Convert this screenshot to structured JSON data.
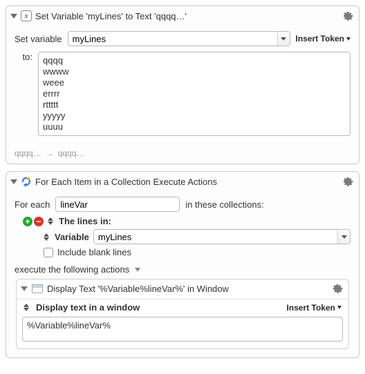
{
  "action1": {
    "title": "Set Variable 'myLines' to Text 'qqqq…'",
    "set_variable_label": "Set variable",
    "variable_name": "myLines",
    "insert_token_label": "Insert Token",
    "to_label": "to:",
    "text_value": "qqqq\nwwww\nweee\nerrrr\nrttttt\nyyyyy\nuuuu",
    "result_from": "qqqq…",
    "result_arrow": "→",
    "result_to": "qqqq…"
  },
  "action2": {
    "title": "For Each Item in a Collection Execute Actions",
    "for_each_label": "For each",
    "loop_var": "lineVar",
    "in_collections_label": "in these collections:",
    "lines_in_label": "The lines in:",
    "variable_label": "Variable",
    "collection_variable": "myLines",
    "include_blank_label": "Include blank lines",
    "execute_label": "execute the following actions",
    "sub": {
      "title": "Display Text '%Variable%lineVar%' in Window",
      "mode_label": "Display text in a window",
      "insert_token_label": "Insert Token",
      "text_value": "%Variable%lineVar%"
    }
  }
}
